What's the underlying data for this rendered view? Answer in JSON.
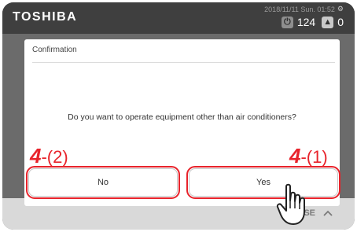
{
  "header": {
    "brand": "TOSHIBA",
    "datetime": "2018/11/11 Sun. 01:52",
    "counter_a": "124",
    "counter_b": "0"
  },
  "icons": {
    "gear": "gear-icon",
    "counter_a": "unit-icon",
    "counter_b": "warning-icon",
    "close": "chevron-up-icon",
    "pointer": "hand-pointer-icon"
  },
  "dialog": {
    "title": "Confirmation",
    "message": "Do you want to operate equipment other than air conditioners?",
    "no_label": "No",
    "yes_label": "Yes"
  },
  "annotations": {
    "left_step_num": "4",
    "left_step_rest": "-(2)",
    "right_step_num": "4",
    "right_step_rest": "-(1)"
  },
  "footer": {
    "close_label": "OSE"
  },
  "colors": {
    "accent_red": "#e8232b",
    "header_bg": "#3f3f3f",
    "overlay_bg": "#6b6b6b"
  }
}
